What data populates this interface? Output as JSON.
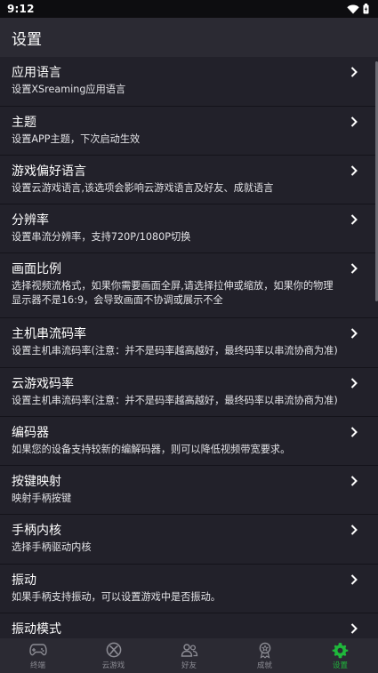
{
  "status": {
    "time": "9:12"
  },
  "header": {
    "title": "设置"
  },
  "settings": [
    {
      "title": "应用语言",
      "desc": "设置XSreaming应用语言"
    },
    {
      "title": "主题",
      "desc": "设置APP主题，下次启动生效"
    },
    {
      "title": "游戏偏好语言",
      "desc": "设置云游戏语言,该选项会影响云游戏语言及好友、成就语言"
    },
    {
      "title": "分辨率",
      "desc": "设置串流分辨率，支持720P/1080P切换"
    },
    {
      "title": "画面比例",
      "desc": "选择视频流格式，如果你需要画面全屏,请选择拉伸或缩放，如果你的物理显示器不是16:9，会导致画面不协调或展示不全"
    },
    {
      "title": "主机串流码率",
      "desc": "设置主机串流码率(注意：并不是码率越高越好，最终码率以串流协商为准)"
    },
    {
      "title": "云游戏码率",
      "desc": "设置主机串流码率(注意：并不是码率越高越好，最终码率以串流协商为准)"
    },
    {
      "title": "编码器",
      "desc": "如果您的设备支持较新的编解码器，则可以降低视频带宽要求。"
    },
    {
      "title": "按键映射",
      "desc": "映射手柄按键"
    },
    {
      "title": "手柄内核",
      "desc": "选择手柄驱动内核"
    },
    {
      "title": "振动",
      "desc": "如果手柄支持振动，可以设置游戏中是否振动。"
    },
    {
      "title": "振动模式",
      "desc": ""
    }
  ],
  "nav": [
    {
      "label": "终端",
      "icon": "gamepad-icon",
      "active": false
    },
    {
      "label": "云游戏",
      "icon": "xbox-icon",
      "active": false
    },
    {
      "label": "好友",
      "icon": "friends-icon",
      "active": false
    },
    {
      "label": "成就",
      "icon": "trophy-icon",
      "active": false
    },
    {
      "label": "设置",
      "icon": "gear-icon",
      "active": true
    }
  ],
  "colors": {
    "accent": "#1fb83b",
    "background": "#1e1d24",
    "row": "#22212a",
    "bar": "#2b2a33"
  }
}
